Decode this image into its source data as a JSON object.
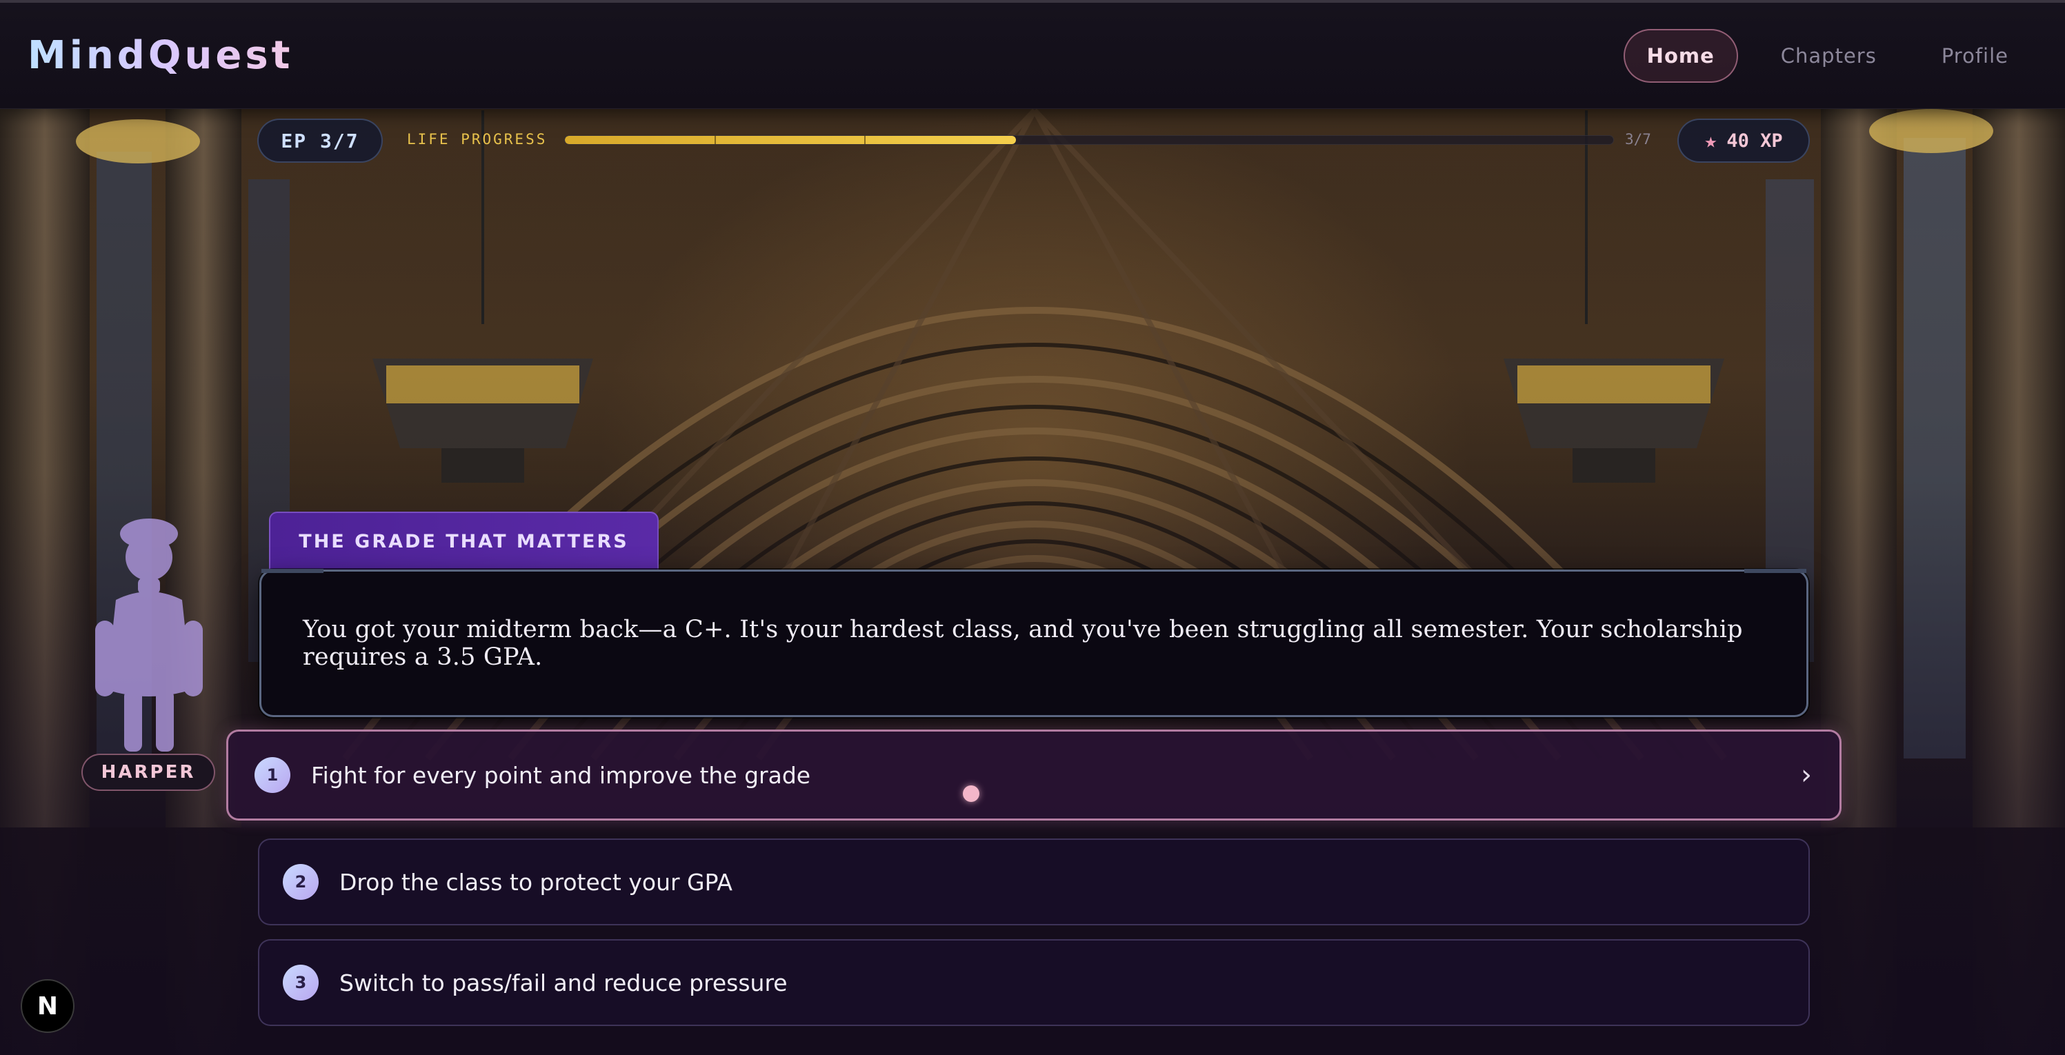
{
  "app": {
    "logo": "MindQuest"
  },
  "nav": {
    "items": [
      {
        "label": "Home",
        "active": true
      },
      {
        "label": "Chapters",
        "active": false
      },
      {
        "label": "Profile",
        "active": false
      }
    ]
  },
  "progress": {
    "episode_label": "EP 3/7",
    "life_label": "LIFE PROGRESS",
    "count_label": "3/7",
    "current": 3,
    "total": 7,
    "fill_fraction": 0.43,
    "bar_color": "#f4cf4c"
  },
  "xp": {
    "icon": "star-icon",
    "label": "40 XP"
  },
  "character": {
    "name": "HARPER",
    "silhouette_color": "#a892d6"
  },
  "scene": {
    "title": "THE GRADE THAT MATTERS",
    "dialog": "You got your midterm back—a C+. It's your hardest class, and you've been struggling all semester. Your scholarship requires a 3.5 GPA."
  },
  "choices": [
    {
      "number": "1",
      "text": "Fight for every point and improve the grade",
      "selected": true,
      "chevron": "›"
    },
    {
      "number": "2",
      "text": "Drop the class to protect your GPA",
      "selected": false
    },
    {
      "number": "3",
      "text": "Switch to pass/fail and reduce pressure",
      "selected": false
    }
  ],
  "corner_badge": {
    "label": "N"
  },
  "colors": {
    "accent_pink": "#f3b6c9",
    "accent_purple": "#5a2aa7",
    "progress_gold": "#f4cf4c"
  }
}
